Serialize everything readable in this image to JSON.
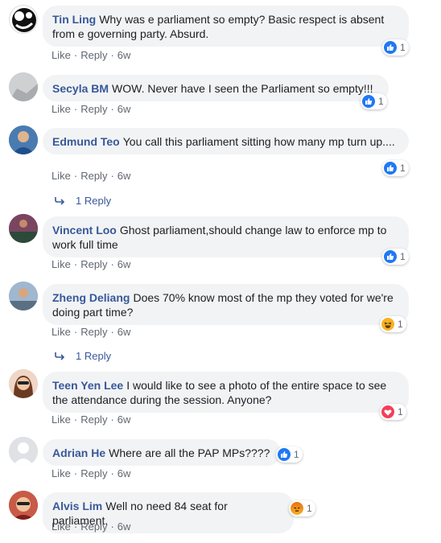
{
  "actions": {
    "like": "Like",
    "reply": "Reply",
    "sep": "·"
  },
  "comments": [
    {
      "author": "Tin Ling",
      "text": "Why was e parliament so empty? Basic respect is absent from e governing party. Absurd.",
      "time": "6w",
      "reaction": "like",
      "reaction_count": "1"
    },
    {
      "author": "Secyla BM",
      "text": "WOW. Never have I seen the Parliament so empty!!!",
      "time": "6w",
      "reaction": "like",
      "reaction_count": "1"
    },
    {
      "author": "Edmund Teo",
      "text": "You call this parliament sitting how many mp turn up....",
      "time": "6w",
      "reaction": "like",
      "reaction_count": "1",
      "replies": "1 Reply"
    },
    {
      "author": "Vincent Loo",
      "text": "Ghost parliament,should change law to enforce mp to work full time",
      "time": "6w",
      "reaction": "like",
      "reaction_count": "1"
    },
    {
      "author": "Zheng Deliang",
      "text": "Does 70% know most of the mp they voted for we're doing part time?",
      "time": "6w",
      "reaction": "haha",
      "reaction_count": "1",
      "replies": "1 Reply"
    },
    {
      "author": "Teen Yen Lee",
      "text": "I would like to see a photo of the entire space to see the attendance during the session. Anyone?",
      "time": "6w",
      "reaction": "love",
      "reaction_count": "1"
    },
    {
      "author": "Adrian He",
      "text": "Where are all the PAP MPs????",
      "time": "6w",
      "reaction": "like",
      "reaction_count": "1"
    },
    {
      "author": "Alvis Lim",
      "text": "Well no need 84 seat for parliament.",
      "time": "6w",
      "reaction": "angry",
      "reaction_count": "1"
    }
  ]
}
